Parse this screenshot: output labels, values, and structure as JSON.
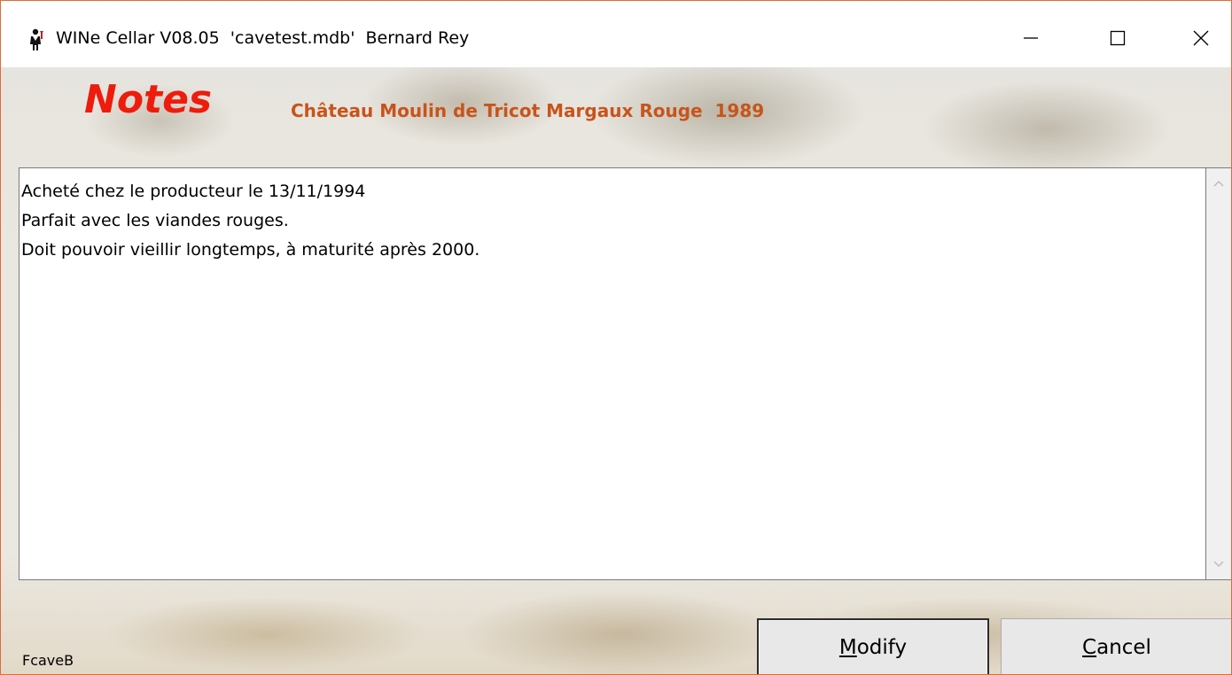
{
  "window": {
    "title": "WINe Cellar V08.05  'cavetest.mdb'  Bernard Rey",
    "icon": "waiter-icon",
    "controls": {
      "minimize": "minimize-icon",
      "maximize": "maximize-icon",
      "close": "close-icon"
    },
    "border_color": "#e06a3a"
  },
  "header": {
    "heading": "Notes",
    "heading_color": "#ee1c0c",
    "wine_name": "Château Moulin de Tricot Margaux Rouge  1989",
    "wine_name_color": "#c8541a"
  },
  "notes": {
    "lines": [
      "Acheté chez le producteur le 13/11/1994",
      "Parfait avec les viandes rouges.",
      "Doit pouvoir vieillir longtemps, à maturité après 2000."
    ]
  },
  "buttons": {
    "modify": {
      "accel": "M",
      "rest": "odify"
    },
    "cancel": {
      "accel": "C",
      "rest": "ancel"
    }
  },
  "status": {
    "form_name": "FcaveB"
  }
}
